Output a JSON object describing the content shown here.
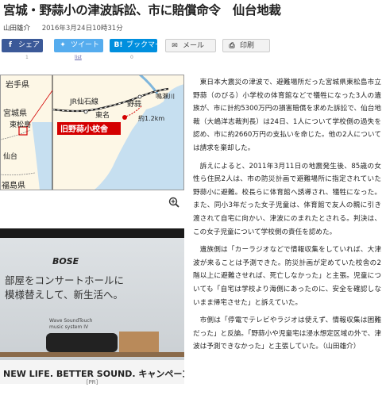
{
  "headline": "宮城・野蒜小の津波訴訟、市に賠償命令　仙台地裁",
  "byline": {
    "author": "山田雄介",
    "date": "2016年3月24日10時31分"
  },
  "share": {
    "facebook": {
      "label": "シェア",
      "count": "1"
    },
    "twitter": {
      "label": "ツイート",
      "count": "list"
    },
    "hatena": {
      "label": "ブックマーク",
      "count": "0"
    },
    "mail": {
      "label": "メール"
    },
    "print": {
      "label": "印刷"
    }
  },
  "map": {
    "labels": {
      "iwate": "岩手県",
      "miyagi": "宮城県",
      "higashimatsushima": "東松島",
      "sendai": "仙台",
      "fukushima": "福島県",
      "jr_senseki": "JR仙石線",
      "nobiru": "野蒜",
      "naruse": "鳴瀬川",
      "tona": "東名",
      "distance": "約1.2km",
      "school": "旧野蒜小校舎"
    },
    "colors": {
      "land": "#fdf7e6",
      "sea": "#c6dff0",
      "red": "#d40000",
      "frame": "#222222"
    }
  },
  "ad": {
    "brand": "BOSE",
    "copy_line1": "部屋をコンサートホールに",
    "copy_line2": "模様替えして、新生活へ。",
    "product_line1": "Wave SoundTouch",
    "product_line2": "music system IV",
    "tagline": "NEW LIFE. BETTER SOUND. キャンペーン",
    "pr": "[PR]"
  },
  "article": {
    "paragraphs": [
      "東日本大震災の津波で、避難場所だった宮城県東松島市立野蒜（のびる）小学校の体育館などで犠牲になった3人の遺族が、市に計約5300万円の損害賠償を求めた訴訟で、仙台地裁（大嶋洋志裁判長）は24日、1人について学校側の過失を認め、市に約2660万円の支払いを命じた。他の2人については請求を棄却した。",
      "訴えによると、2011年3月11日の地震発生後、85歳の女性ら住民2人は、市の防災計画で避難場所に指定されていた野蒜小に避難。校長らに体育館へ誘導され、犠牲になった。また、同小3年だった女子児童は、体育館で友人の親に引き渡されて自宅に向かい、津波にのまれたとされる。判決は、この女子児童について学校側の責任を認めた。",
      "遺族側は「カーラジオなどで情報収集をしていれば、大津波が来ることは予測できた。防災計画が定めていた校舎の2階以上に避難させれば、死亡しなかった」と主張。児童についても「自宅は学校より海側にあったのに、安全を確認しないまま帰宅させた」と訴えていた。",
      "市側は「停電でテレビやラジオは使えず、情報収集は困難だった」と反論。「野蒜小や児童宅は浸水想定区域の外で、津波は予測できなかった」と主張していた。（山田雄介）"
    ]
  }
}
